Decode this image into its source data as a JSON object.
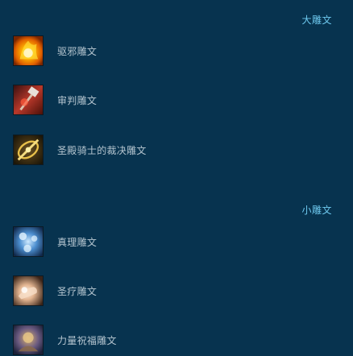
{
  "sections": {
    "major": {
      "title": "大雕文",
      "items": [
        {
          "label": "驱邪雕文",
          "icon": "flame-sun-icon"
        },
        {
          "label": "审判雕文",
          "icon": "judgement-hammer-icon"
        },
        {
          "label": "圣殿骑士的裁决雕文",
          "icon": "golden-sword-icon"
        }
      ]
    },
    "minor": {
      "title": "小雕文",
      "items": [
        {
          "label": "真理雕文",
          "icon": "blue-light-icon"
        },
        {
          "label": "圣疗雕文",
          "icon": "healing-hands-icon"
        },
        {
          "label": "力量祝福雕文",
          "icon": "might-blessing-icon"
        }
      ]
    }
  },
  "colors": {
    "background": "#07334f",
    "section_header": "#6ec9ef",
    "item_label": "#b6c6d0"
  }
}
